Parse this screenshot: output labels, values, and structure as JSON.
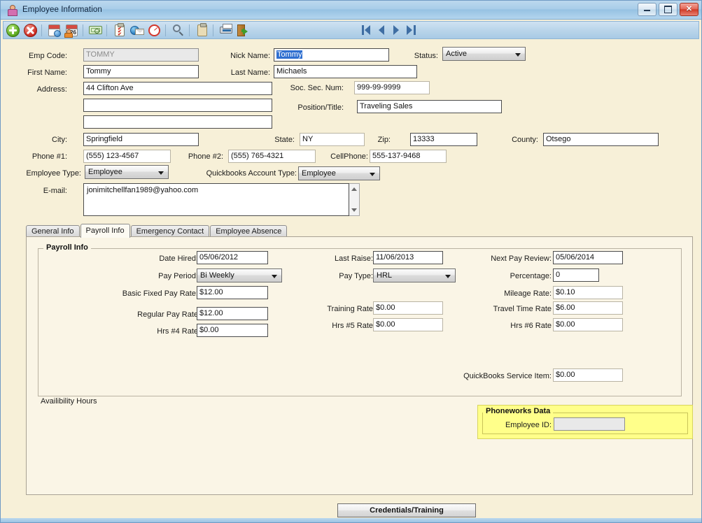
{
  "window": {
    "title": "Employee Information",
    "icon": "employee-icon",
    "minimize_label": "Minimize",
    "maximize_label": "Maximize",
    "close_label": "Close"
  },
  "toolbar": {
    "icons": [
      {
        "name": "add-icon",
        "label": "Add"
      },
      {
        "name": "delete-icon",
        "label": "Delete"
      },
      {
        "name": "calendar-search-icon",
        "label": "Calendar Lookup"
      },
      {
        "name": "calendar-person-icon",
        "label": "Schedule",
        "day": "26"
      },
      {
        "name": "money-icon",
        "label": "Payroll"
      },
      {
        "name": "checklist-icon",
        "label": "Checklist"
      },
      {
        "name": "email-globe-icon",
        "label": "Send Email"
      },
      {
        "name": "clock-icon",
        "label": "Time Clock"
      },
      {
        "name": "search-icon",
        "label": "Search"
      },
      {
        "name": "clipboard-icon",
        "label": "Notes"
      },
      {
        "name": "print-icon",
        "label": "Print"
      },
      {
        "name": "exit-icon",
        "label": "Exit"
      }
    ],
    "nav": [
      {
        "name": "nav-first-button",
        "label": "First"
      },
      {
        "name": "nav-prev-button",
        "label": "Previous"
      },
      {
        "name": "nav-next-button",
        "label": "Next"
      },
      {
        "name": "nav-last-button",
        "label": "Last"
      }
    ]
  },
  "general": {
    "emp_code_label": "Emp Code:",
    "emp_code_value": "TOMMY",
    "first_name_label": "First Name:",
    "first_name_value": "Tommy",
    "address_label": "Address:",
    "address_line1": "44 Clifton Ave",
    "address_line2": "",
    "address_line3": "",
    "city_label": "City:",
    "city_value": "Springfield",
    "phone1_label": "Phone #1:",
    "phone1_value": "(555) 123-4567",
    "phone2_label": "Phone #2:",
    "phone2_value": "(555) 765-4321",
    "cellphone_label": "CellPhone:",
    "cellphone_value": "555-137-9468",
    "employee_type_label": "Employee Type:",
    "employee_type_value": "Employee",
    "quickbooks_account_type_label": "Quickbooks Account Type:",
    "quickbooks_account_type_value": "Employee",
    "email_label": "E-mail:",
    "email_value": "jonimitchellfan1989@yahoo.com",
    "nick_name_label": "Nick Name:",
    "nick_name_value": "Tommy",
    "last_name_label": "Last Name:",
    "last_name_value": "Michaels",
    "ssn_label": "Soc. Sec. Num:",
    "ssn_value": "999-99-9999",
    "position_label": "Position/Title:",
    "position_value": "Traveling Sales",
    "status_label": "Status:",
    "status_value": "Active",
    "state_label": "State:",
    "state_value": "NY",
    "zip_label": "Zip:",
    "zip_value": "13333",
    "county_label": "County:",
    "county_value": "Otsego"
  },
  "tabs": [
    {
      "label": "General Info",
      "name": "tab-general-info",
      "active": false
    },
    {
      "label": "Payroll Info",
      "name": "tab-payroll-info",
      "active": true
    },
    {
      "label": "Emergency Contact",
      "name": "tab-emergency-contact",
      "active": false
    },
    {
      "label": "Employee Absence",
      "name": "tab-employee-absence",
      "active": false
    }
  ],
  "payroll": {
    "group_title": "Payroll Info",
    "date_hired_label": "Date Hired:",
    "date_hired_value": "05/06/2012",
    "pay_period_label": "Pay Period:",
    "pay_period_value": "Bi Weekly",
    "basic_fixed_pay_rate_label": "Basic Fixed Pay Rate:",
    "basic_fixed_pay_rate_value": "$12.00",
    "regular_pay_rate_label": "Regular Pay Rate",
    "regular_pay_rate_value": "$12.00",
    "hrs4_rate_label": "Hrs #4 Rate",
    "hrs4_rate_value": "$0.00",
    "last_raise_label": "Last Raise:",
    "last_raise_value": "11/06/2013",
    "pay_type_label": "Pay Type:",
    "pay_type_value": "HRL",
    "training_rate_label": "Training Rate",
    "training_rate_value": "$0.00",
    "hrs5_rate_label": "Hrs #5 Rate",
    "hrs5_rate_value": "$0.00",
    "next_pay_review_label": "Next Pay Review:",
    "next_pay_review_value": "05/06/2014",
    "percentage_label": "Percentage:",
    "percentage_value": "0",
    "mileage_rate_label": "Mileage Rate:",
    "mileage_rate_value": "$0.10",
    "travel_time_rate_label": "Travel Time Rate",
    "travel_time_rate_value": "$6.00",
    "hrs6_rate_label": "Hrs #6 Rate",
    "hrs6_rate_value": "$0.00",
    "quickbooks_service_item_label": "QuickBooks Service Item:",
    "quickbooks_service_item_value": "$0.00",
    "availability_hours_label": "Availibility Hours"
  },
  "phoneworks": {
    "group_title": "Phoneworks Data",
    "employee_id_label": "Employee ID:",
    "employee_id_value": ""
  },
  "footer": {
    "credentials_button": "Credentials/Training"
  },
  "colors": {
    "form_bg": "#f7f0d8",
    "panel_bg": "#faf5e6",
    "titlebar": "#a9cde9",
    "phoneworks_bg": "#ffff8a",
    "selection": "#2f6fd0",
    "close_button": "#d03b28"
  }
}
